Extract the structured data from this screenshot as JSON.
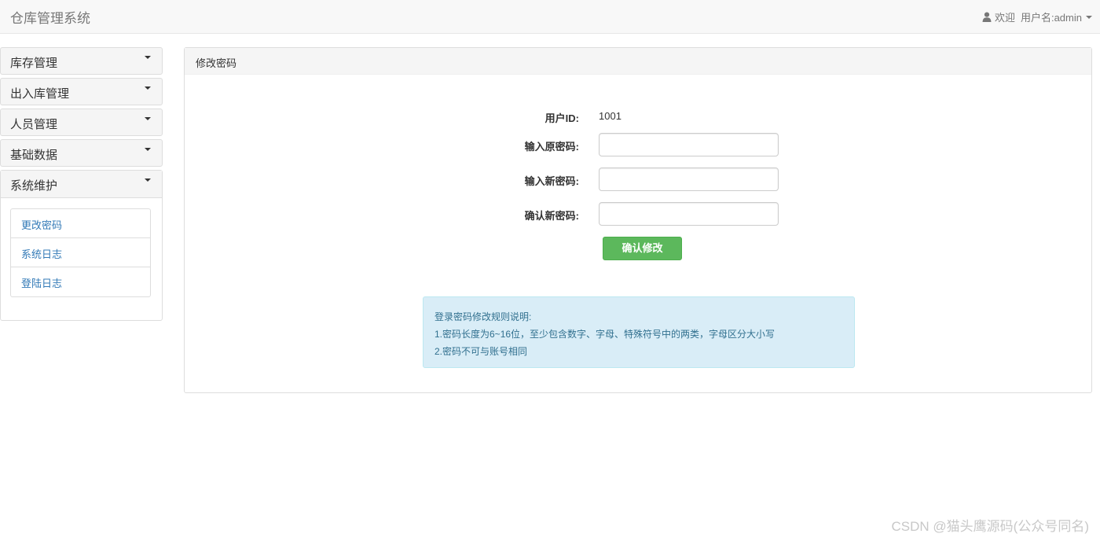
{
  "app": {
    "title": "仓库管理系统"
  },
  "header": {
    "user_icon": "user-icon",
    "welcome": "欢迎",
    "username_label": "用户名:admin"
  },
  "sidebar": {
    "groups": [
      {
        "label": "库存管理",
        "expanded": false
      },
      {
        "label": "出入库管理",
        "expanded": false
      },
      {
        "label": "人员管理",
        "expanded": false
      },
      {
        "label": "基础数据",
        "expanded": false
      },
      {
        "label": "系统维护",
        "expanded": true
      }
    ],
    "sub_items": [
      {
        "label": "更改密码"
      },
      {
        "label": "系统日志"
      },
      {
        "label": "登陆日志"
      }
    ]
  },
  "main": {
    "panel_title": "修改密码",
    "form": {
      "user_id_label": "用户ID:",
      "user_id_value": "1001",
      "old_password_label": "输入原密码:",
      "old_password_value": "",
      "new_password_label": "输入新密码:",
      "new_password_value": "",
      "confirm_password_label": "确认新密码:",
      "confirm_password_value": "",
      "submit_label": "确认修改"
    },
    "rules": {
      "title": "登录密码修改规则说明:",
      "line1": "1.密码长度为6~16位，至少包含数字、字母、特殊符号中的两类，字母区分大小写",
      "line2": "2.密码不可与账号相同"
    }
  },
  "watermark": "CSDN @猫头鹰源码(公众号同名)",
  "colors": {
    "accent_green": "#5cb85c",
    "link_blue": "#337ab7",
    "info_bg": "#d9edf7",
    "info_text": "#31708f"
  }
}
